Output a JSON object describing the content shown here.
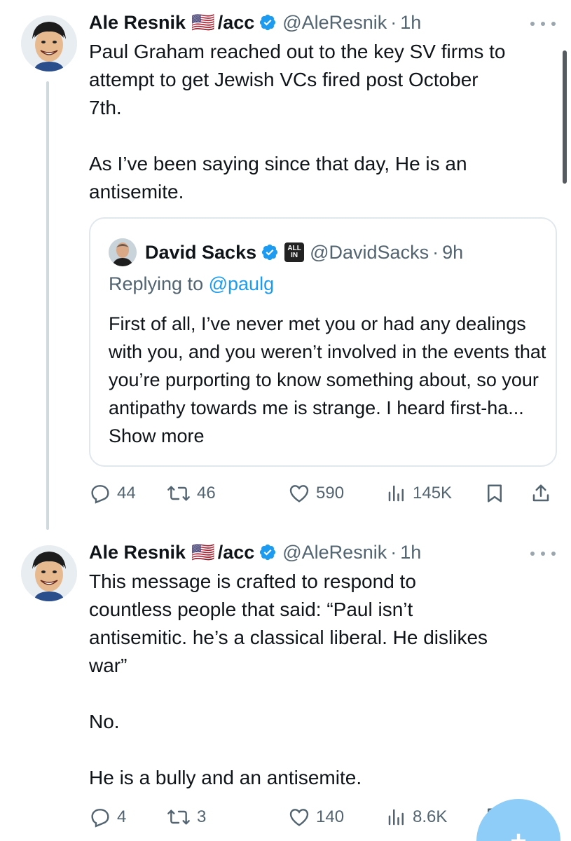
{
  "tweets": [
    {
      "author": {
        "name": "Ale Resnik",
        "flag": "🇺🇸",
        "suffix": "/acc",
        "handle": "@AleResnik",
        "time": "1h"
      },
      "text": "Paul Graham reached out to the key SV firms to\nattempt to get Jewish VCs fired post October\n7th.\n\nAs I’ve been saying since that day, He is an\nantisemite.",
      "quote": {
        "name": "David Sacks",
        "badge_top": "ALL",
        "badge_bottom": "IN",
        "handle": "@DavidSacks",
        "time": "9h",
        "replying_prefix": "Replying to",
        "replying_to": "@paulg",
        "text": "First of all, I’ve never met you or had any dealings with you, and you weren’t involved in the events that you’re purporting to know something about, so your antipathy towards me is strange. I heard first-ha...",
        "show_more": "Show more"
      },
      "stats": {
        "replies": "44",
        "reposts": "46",
        "likes": "590",
        "views": "145K"
      }
    },
    {
      "author": {
        "name": "Ale Resnik",
        "flag": "🇺🇸",
        "suffix": "/acc",
        "handle": "@AleResnik",
        "time": "1h"
      },
      "text": "This message is crafted to respond to\ncountless people that said: “Paul isn’t\nantisemitic. he’s a classical liberal. He dislikes\nwar”\n\nNo.\n\nHe is a bully and an antisemite.",
      "stats": {
        "replies": "4",
        "reposts": "3",
        "likes": "140",
        "views": "8.6K"
      }
    }
  ],
  "separator_dot": "·",
  "fab": {
    "label": "+"
  },
  "colors": {
    "text": "#0f1419",
    "muted": "#536471",
    "accent": "#1d9bf0",
    "border": "#e1e8ed",
    "fab": "#8ecdf7"
  },
  "icons": [
    "verified-badge-icon",
    "more-icon",
    "reply-icon",
    "repost-icon",
    "like-icon",
    "views-icon",
    "bookmark-icon",
    "share-icon",
    "compose-icon"
  ]
}
